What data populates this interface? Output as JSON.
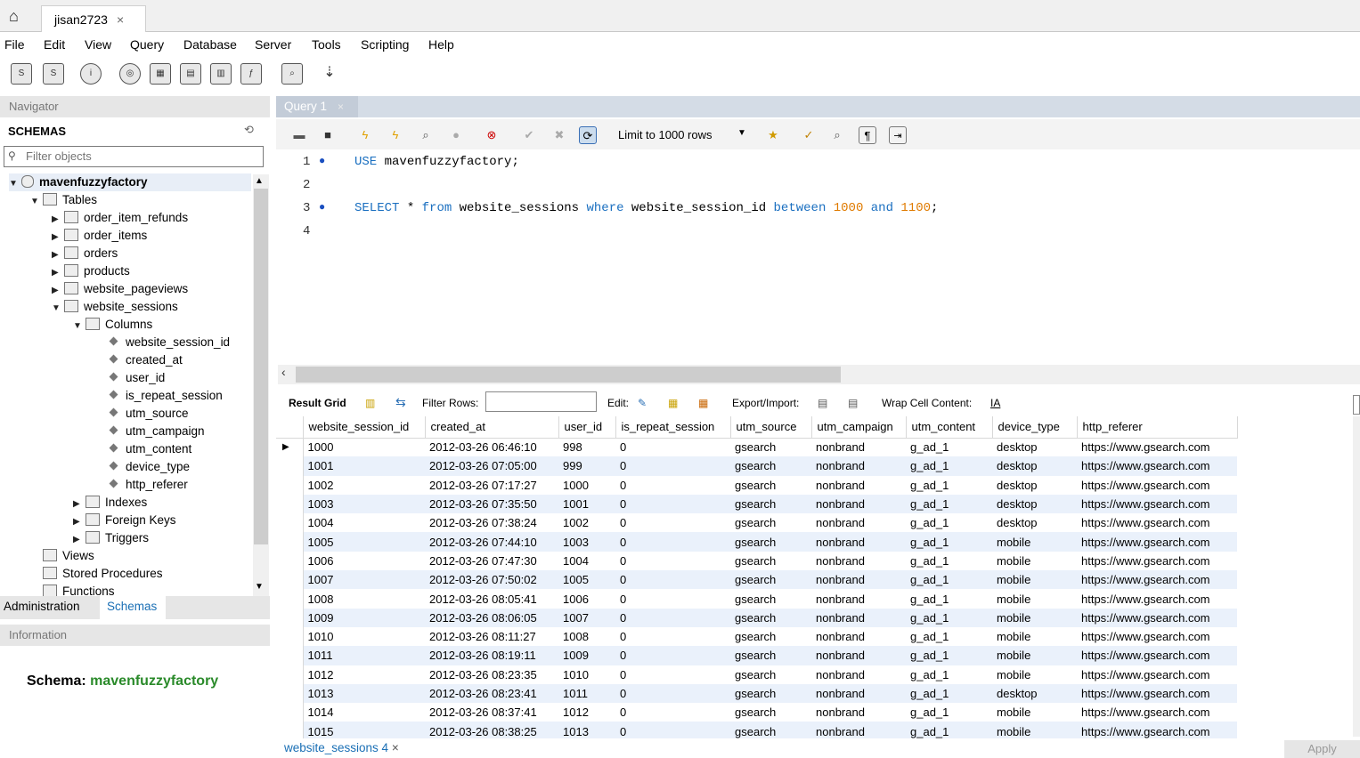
{
  "connection_tab": {
    "title": "jisan2723"
  },
  "menu": [
    "File",
    "Edit",
    "View",
    "Query",
    "Database",
    "Server",
    "Tools",
    "Scripting",
    "Help"
  ],
  "navigator": {
    "header": "Navigator",
    "schemas_label": "SCHEMAS",
    "filter_placeholder": "Filter objects",
    "tree": {
      "schema": "mavenfuzzyfactory",
      "tables_label": "Tables",
      "tables": [
        "order_item_refunds",
        "order_items",
        "orders",
        "products",
        "website_pageviews",
        "website_sessions"
      ],
      "columns_label": "Columns",
      "columns": [
        "website_session_id",
        "created_at",
        "user_id",
        "is_repeat_session",
        "utm_source",
        "utm_campaign",
        "utm_content",
        "device_type",
        "http_referer"
      ],
      "indexes_label": "Indexes",
      "foreign_keys_label": "Foreign Keys",
      "triggers_label": "Triggers",
      "views_label": "Views",
      "stored_procedures_label": "Stored Procedures",
      "functions_label": "Functions"
    },
    "admin_tab": "Administration",
    "schemas_tab": "Schemas"
  },
  "information": {
    "header": "Information",
    "schema_label": "Schema:",
    "schema_value": "mavenfuzzyfactory"
  },
  "query_tab": {
    "title": "Query 1"
  },
  "editor_toolbar": {
    "limit": "Limit to 1000 rows"
  },
  "editor": {
    "line_numbers": [
      "1",
      "2",
      "3",
      "4"
    ],
    "line1": {
      "kw": "USE",
      "rest": " mavenfuzzyfactory;"
    },
    "line3": {
      "p1": "SELECT",
      "p2": " * ",
      "p3": "from",
      "p4": " website_sessions ",
      "p5": "where",
      "p6": " website_session_id ",
      "p7": "between",
      "p8": " ",
      "p9": "1000",
      "p10": " ",
      "p11": "and",
      "p12": " ",
      "p13": "1100",
      "p14": ";"
    }
  },
  "result_toolbar": {
    "result_grid": "Result Grid",
    "filter_rows": "Filter Rows:",
    "edit": "Edit:",
    "export_import": "Export/Import:",
    "wrap": "Wrap Cell Content:"
  },
  "grid": {
    "columns": [
      "website_session_id",
      "created_at",
      "user_id",
      "is_repeat_session",
      "utm_source",
      "utm_campaign",
      "utm_content",
      "device_type",
      "http_referer"
    ],
    "rows": [
      [
        "1000",
        "2012-03-26 06:46:10",
        "998",
        "0",
        "gsearch",
        "nonbrand",
        "g_ad_1",
        "desktop",
        "https://www.gsearch.com"
      ],
      [
        "1001",
        "2012-03-26 07:05:00",
        "999",
        "0",
        "gsearch",
        "nonbrand",
        "g_ad_1",
        "desktop",
        "https://www.gsearch.com"
      ],
      [
        "1002",
        "2012-03-26 07:17:27",
        "1000",
        "0",
        "gsearch",
        "nonbrand",
        "g_ad_1",
        "desktop",
        "https://www.gsearch.com"
      ],
      [
        "1003",
        "2012-03-26 07:35:50",
        "1001",
        "0",
        "gsearch",
        "nonbrand",
        "g_ad_1",
        "desktop",
        "https://www.gsearch.com"
      ],
      [
        "1004",
        "2012-03-26 07:38:24",
        "1002",
        "0",
        "gsearch",
        "nonbrand",
        "g_ad_1",
        "desktop",
        "https://www.gsearch.com"
      ],
      [
        "1005",
        "2012-03-26 07:44:10",
        "1003",
        "0",
        "gsearch",
        "nonbrand",
        "g_ad_1",
        "mobile",
        "https://www.gsearch.com"
      ],
      [
        "1006",
        "2012-03-26 07:47:30",
        "1004",
        "0",
        "gsearch",
        "nonbrand",
        "g_ad_1",
        "mobile",
        "https://www.gsearch.com"
      ],
      [
        "1007",
        "2012-03-26 07:50:02",
        "1005",
        "0",
        "gsearch",
        "nonbrand",
        "g_ad_1",
        "mobile",
        "https://www.gsearch.com"
      ],
      [
        "1008",
        "2012-03-26 08:05:41",
        "1006",
        "0",
        "gsearch",
        "nonbrand",
        "g_ad_1",
        "mobile",
        "https://www.gsearch.com"
      ],
      [
        "1009",
        "2012-03-26 08:06:05",
        "1007",
        "0",
        "gsearch",
        "nonbrand",
        "g_ad_1",
        "mobile",
        "https://www.gsearch.com"
      ],
      [
        "1010",
        "2012-03-26 08:11:27",
        "1008",
        "0",
        "gsearch",
        "nonbrand",
        "g_ad_1",
        "mobile",
        "https://www.gsearch.com"
      ],
      [
        "1011",
        "2012-03-26 08:19:11",
        "1009",
        "0",
        "gsearch",
        "nonbrand",
        "g_ad_1",
        "mobile",
        "https://www.gsearch.com"
      ],
      [
        "1012",
        "2012-03-26 08:23:35",
        "1010",
        "0",
        "gsearch",
        "nonbrand",
        "g_ad_1",
        "mobile",
        "https://www.gsearch.com"
      ],
      [
        "1013",
        "2012-03-26 08:23:41",
        "1011",
        "0",
        "gsearch",
        "nonbrand",
        "g_ad_1",
        "desktop",
        "https://www.gsearch.com"
      ],
      [
        "1014",
        "2012-03-26 08:37:41",
        "1012",
        "0",
        "gsearch",
        "nonbrand",
        "g_ad_1",
        "mobile",
        "https://www.gsearch.com"
      ],
      [
        "1015",
        "2012-03-26 08:38:25",
        "1013",
        "0",
        "gsearch",
        "nonbrand",
        "g_ad_1",
        "mobile",
        "https://www.gsearch.com"
      ]
    ]
  },
  "result_tab": {
    "title": "website_sessions 4"
  },
  "apply_button": "Apply",
  "colors": {
    "keyword": "#1a6fc0",
    "number": "#e07b00",
    "schema_name": "#2a8a2a",
    "selected_row": "#eaf1fb"
  }
}
